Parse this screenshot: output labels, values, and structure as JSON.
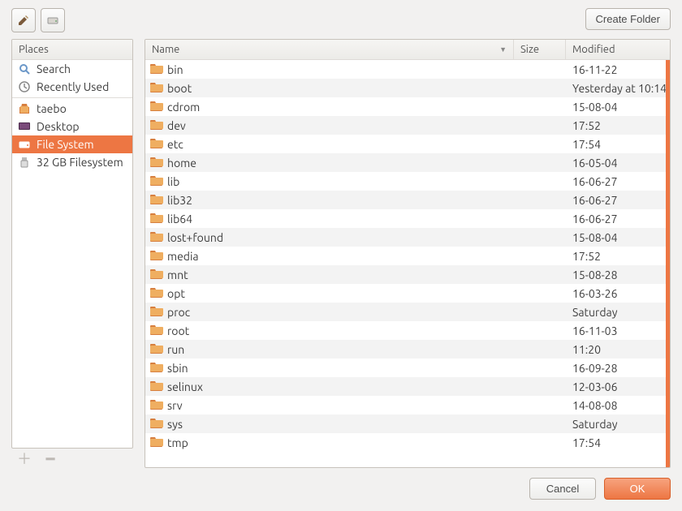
{
  "toolbar": {
    "create_folder_label": "Create Folder"
  },
  "sidebar": {
    "header": "Places",
    "groups": [
      [
        {
          "icon": "search",
          "label": "Search"
        },
        {
          "icon": "recent",
          "label": "Recently Used"
        }
      ],
      [
        {
          "icon": "home",
          "label": "taebo"
        },
        {
          "icon": "desktop",
          "label": "Desktop"
        },
        {
          "icon": "drive",
          "label": "File System",
          "selected": true
        },
        {
          "icon": "usb",
          "label": "32 GB Filesystem"
        }
      ]
    ]
  },
  "columns": {
    "name": "Name",
    "size": "Size",
    "modified": "Modified"
  },
  "files": [
    {
      "name": "bin",
      "size": "",
      "modified": "16-11-22"
    },
    {
      "name": "boot",
      "size": "",
      "modified": "Yesterday at 10:14"
    },
    {
      "name": "cdrom",
      "size": "",
      "modified": "15-08-04"
    },
    {
      "name": "dev",
      "size": "",
      "modified": "17:52"
    },
    {
      "name": "etc",
      "size": "",
      "modified": "17:54"
    },
    {
      "name": "home",
      "size": "",
      "modified": "16-05-04"
    },
    {
      "name": "lib",
      "size": "",
      "modified": "16-06-27"
    },
    {
      "name": "lib32",
      "size": "",
      "modified": "16-06-27"
    },
    {
      "name": "lib64",
      "size": "",
      "modified": "16-06-27"
    },
    {
      "name": "lost+found",
      "size": "",
      "modified": "15-08-04"
    },
    {
      "name": "media",
      "size": "",
      "modified": "17:52"
    },
    {
      "name": "mnt",
      "size": "",
      "modified": "15-08-28"
    },
    {
      "name": "opt",
      "size": "",
      "modified": "16-03-26"
    },
    {
      "name": "proc",
      "size": "",
      "modified": "Saturday"
    },
    {
      "name": "root",
      "size": "",
      "modified": "16-11-03"
    },
    {
      "name": "run",
      "size": "",
      "modified": "11:20"
    },
    {
      "name": "sbin",
      "size": "",
      "modified": "16-09-28"
    },
    {
      "name": "selinux",
      "size": "",
      "modified": "12-03-06"
    },
    {
      "name": "srv",
      "size": "",
      "modified": "14-08-08"
    },
    {
      "name": "sys",
      "size": "",
      "modified": "Saturday"
    },
    {
      "name": "tmp",
      "size": "",
      "modified": "17:54"
    }
  ],
  "footer": {
    "cancel": "Cancel",
    "ok": "OK"
  }
}
